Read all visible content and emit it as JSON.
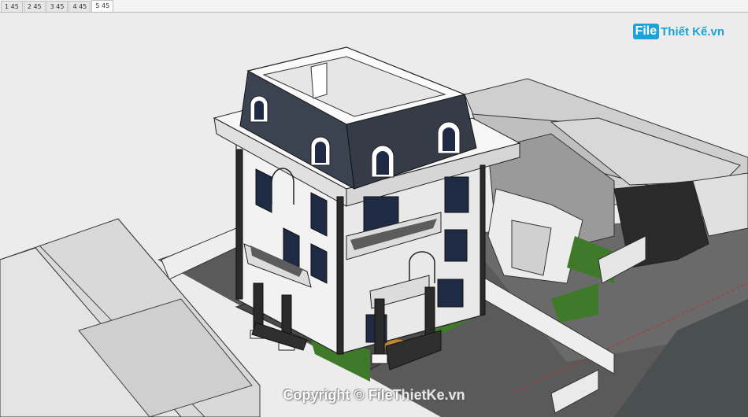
{
  "tabs": [
    "1 45",
    "2 45",
    "3 45",
    "4 45",
    "5 45"
  ],
  "active_tab": 4,
  "watermark": {
    "brand_box": "File",
    "brand_rest": "Thiết Kế.vn"
  },
  "copyright": "Copyright © FileThietKe.vn",
  "colors": {
    "sky": "#ececec",
    "ground": "#5a5a5a",
    "roof_slate": "#3c4350",
    "wall": "#f4f4f4",
    "window": "#1f2a44",
    "lawn": "#3f7a2a",
    "watermark_blue": "#1aa3d9"
  }
}
